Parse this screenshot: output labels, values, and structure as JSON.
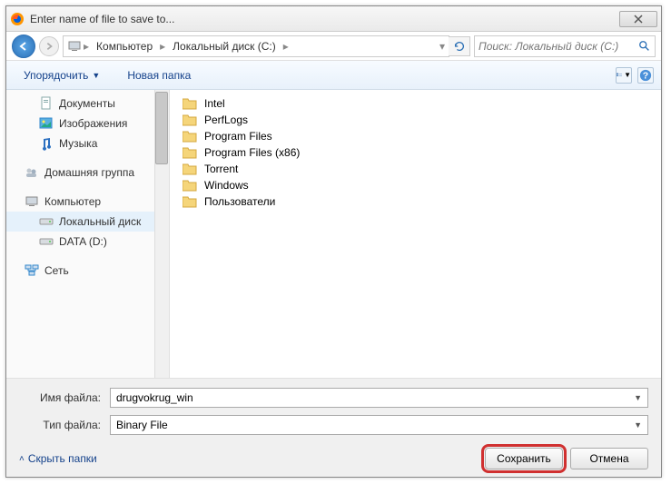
{
  "window": {
    "title": "Enter name of file to save to..."
  },
  "breadcrumb": {
    "computer": "Компьютер",
    "drive": "Локальный диск (C:)"
  },
  "search": {
    "placeholder": "Поиск: Локальный диск (C:)"
  },
  "toolbar": {
    "organize": "Упорядочить",
    "new_folder": "Новая папка"
  },
  "sidebar": {
    "libs": {
      "documents": "Документы",
      "pictures": "Изображения",
      "music": "Музыка"
    },
    "homegroup": "Домашняя группа",
    "computer": "Компьютер",
    "drives": {
      "c": "Локальный диск",
      "d": "DATA (D:)"
    },
    "network": "Сеть"
  },
  "files": [
    "Intel",
    "PerfLogs",
    "Program Files",
    "Program Files (x86)",
    "Torrent",
    "Windows",
    "Пользователи"
  ],
  "form": {
    "filename_label": "Имя файла:",
    "filename_value": "drugvokrug_win",
    "filetype_label": "Тип файла:",
    "filetype_value": "Binary File",
    "hide_folders": "Скрыть папки",
    "save": "Сохранить",
    "cancel": "Отмена"
  }
}
